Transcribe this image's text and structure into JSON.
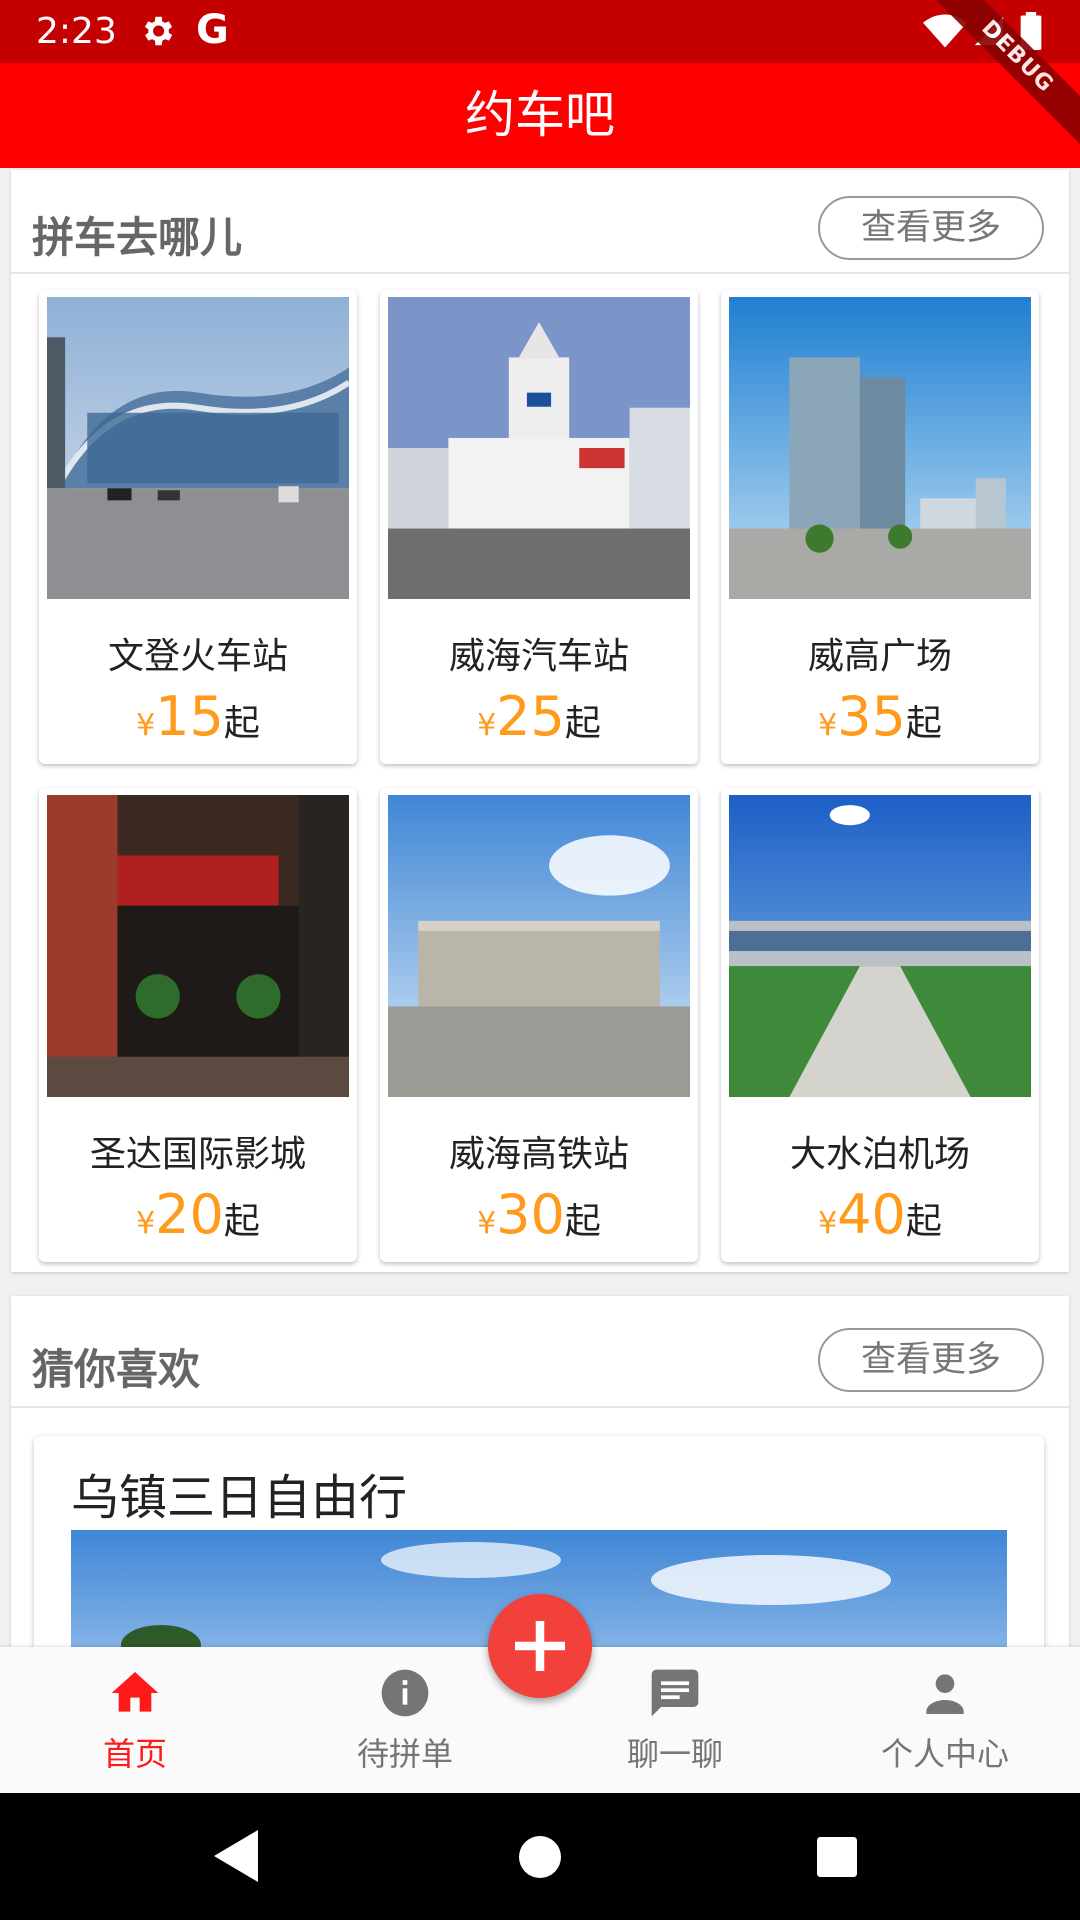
{
  "status_bar": {
    "time": "2:23"
  },
  "app_bar": {
    "title": "约车吧",
    "debug_label": "DEBUG"
  },
  "section_destinations": {
    "title": "拼车去哪儿",
    "more_label": "查看更多",
    "price_currency": "¥",
    "price_suffix": "起",
    "items": [
      {
        "name": "文登火车站",
        "price": "15",
        "image": "train-station-photo"
      },
      {
        "name": "威海汽车站",
        "price": "25",
        "image": "bus-station-photo"
      },
      {
        "name": "威高广场",
        "price": "35",
        "image": "plaza-photo"
      },
      {
        "name": "圣达国际影城",
        "price": "20",
        "image": "cinema-photo"
      },
      {
        "name": "威海高铁站",
        "price": "30",
        "image": "high-speed-rail-station-photo"
      },
      {
        "name": "大水泊机场",
        "price": "40",
        "image": "airport-photo"
      }
    ]
  },
  "section_recommend": {
    "title": "猜你喜欢",
    "more_label": "查看更多",
    "trip": {
      "title": "乌镇三日自由行",
      "image": "sky-landscape-photo"
    }
  },
  "bottom_nav": {
    "items": [
      {
        "label": "首页",
        "icon": "home-icon",
        "active": true
      },
      {
        "label": "待拼单",
        "icon": "info-icon",
        "active": false
      },
      {
        "label": "聊一聊",
        "icon": "chat-icon",
        "active": false
      },
      {
        "label": "个人中心",
        "icon": "person-icon",
        "active": false
      }
    ],
    "fab_icon": "plus-icon"
  },
  "colors": {
    "status_bar": "#c40000",
    "app_bar": "#ff0000",
    "price": "#ff9a1a",
    "nav_active": "#ff1a1a",
    "fab": "#f2403a"
  }
}
